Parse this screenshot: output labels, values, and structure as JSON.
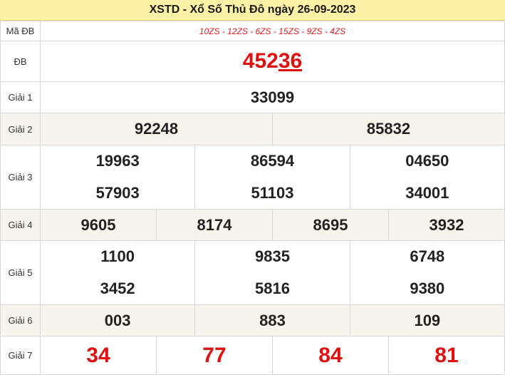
{
  "title": "XSTD - Xổ Số Thủ Đô ngày 26-09-2023",
  "ma_db": {
    "label": "Mã ĐB",
    "value": "10ZS - 12ZS - 6ZS - 15ZS - 9ZS - 4ZS"
  },
  "dac_biet": {
    "label": "ĐB",
    "prefix": "452",
    "suffix": "36"
  },
  "giai_1": {
    "label": "Giải 1",
    "numbers": [
      "33099"
    ]
  },
  "giai_2": {
    "label": "Giải 2",
    "numbers": [
      "92248",
      "85832"
    ]
  },
  "giai_3": {
    "label": "Giải 3",
    "numbers": [
      "19963",
      "86594",
      "04650",
      "57903",
      "51103",
      "34001"
    ]
  },
  "giai_4": {
    "label": "Giải 4",
    "numbers": [
      "9605",
      "8174",
      "8695",
      "3932"
    ]
  },
  "giai_5": {
    "label": "Giải 5",
    "numbers": [
      "1100",
      "9835",
      "6748",
      "3452",
      "5816",
      "9380"
    ]
  },
  "giai_6": {
    "label": "Giải 6",
    "numbers": [
      "003",
      "883",
      "109"
    ]
  },
  "giai_7": {
    "label": "Giải 7",
    "numbers": [
      "34",
      "77",
      "84",
      "81"
    ]
  },
  "colors": {
    "title_bg": "#fdf1a6",
    "row_shade": "#f7f4ec",
    "highlight_red": "#e01010",
    "border": "#d8d8d8"
  }
}
